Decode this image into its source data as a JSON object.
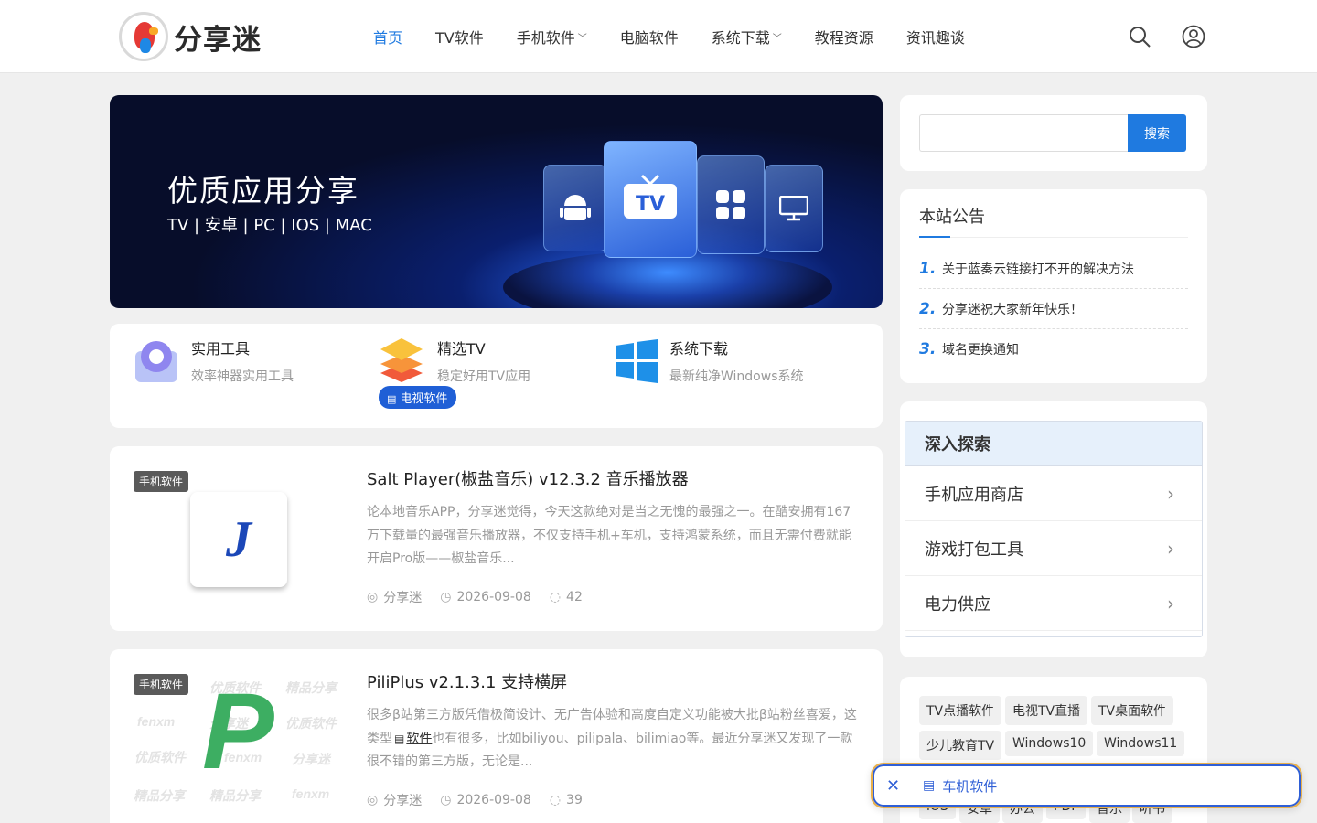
{
  "header": {
    "logo_text": "分享迷",
    "nav": [
      {
        "label": "首页"
      },
      {
        "label": "TV软件"
      },
      {
        "label": "手机软件"
      },
      {
        "label": "电脑软件"
      },
      {
        "label": "系统下载"
      },
      {
        "label": "教程资源"
      },
      {
        "label": "资讯趣谈"
      }
    ],
    "icons": {
      "search": "search-icon",
      "user": "user-icon"
    }
  },
  "banner": {
    "title": "优质应用分享",
    "subtitle": "TV | 安卓 | PC | IOS | MAC",
    "tv_label": "TV"
  },
  "categories": [
    {
      "title": "实用工具",
      "desc": "效率神器实用工具",
      "icon": "tools-icon"
    },
    {
      "title": "精选TV",
      "desc": "稳定好用TV应用",
      "icon": "tv-layers-icon"
    },
    {
      "title": "系统下载",
      "desc": "最新纯净Windows系统",
      "icon": "windows-icon"
    }
  ],
  "popup_tag": "电视软件",
  "posts": [
    {
      "badge": "手机软件",
      "title": "Salt Player(椒盐音乐) v12.3.2 音乐播放器",
      "excerpt": "论本地音乐APP，分享迷觉得，今天这款绝对是当之无愧的最强之一。在酷安拥有167万下载量的最强音乐播放器，不仅支持手机+车机，支持鸿蒙系统，而且无需付费就能开启Pro版——椒盐音乐...",
      "author": "分享迷",
      "date": "2026-09-08",
      "comments": "42",
      "thumb_letter": "J"
    },
    {
      "badge": "手机软件",
      "title": "PiliPlus v2.1.3.1 支持横屏",
      "excerpt_a": "很多β站第三方版凭借极简设计、无广告体验和高度自定义功能被大批β站粉丝喜爱，这类型",
      "excerpt_link": "软件",
      "excerpt_b": "也有很多，比如biliyou、pilipala、bilimiao等。最近分享迷又发现了一款很不错的第三方版，无论是...",
      "author": "分享迷",
      "date": "2026-09-08",
      "comments": "39",
      "thumb_letter": "P",
      "watermarks": [
        "优质软件",
        "精品分享",
        "fenxm",
        "分享迷",
        "优质软件",
        "优质软件",
        "fenxm",
        "分享迷",
        "精品分享",
        "精品分享",
        "fenxm"
      ]
    }
  ],
  "sidebar": {
    "search_button": "搜索",
    "search_placeholder": "",
    "notice_title": "本站公告",
    "notices": [
      {
        "num": "1.",
        "text": "关于蓝奏云链接打不开的解决方法"
      },
      {
        "num": "2.",
        "text": "分享迷祝大家新年快乐！"
      },
      {
        "num": "3.",
        "text": "域名更换通知"
      }
    ],
    "explore_title": "深入探索",
    "explore_items": [
      "手机应用商店",
      "游戏打包工具",
      "电力供应"
    ],
    "tags": [
      "TV点播软件",
      "电视TV直播",
      "TV桌面软件",
      "少儿教育TV",
      "Windows10",
      "Windows11",
      "iOS",
      "安卓",
      "办公",
      "PDF",
      "音乐",
      "听书"
    ]
  },
  "float_bar": {
    "label": "车机软件"
  },
  "colors": {
    "accent": "#1f7ae0",
    "float_border": "#e9b04a",
    "float_inner": "#2f5fd6"
  }
}
